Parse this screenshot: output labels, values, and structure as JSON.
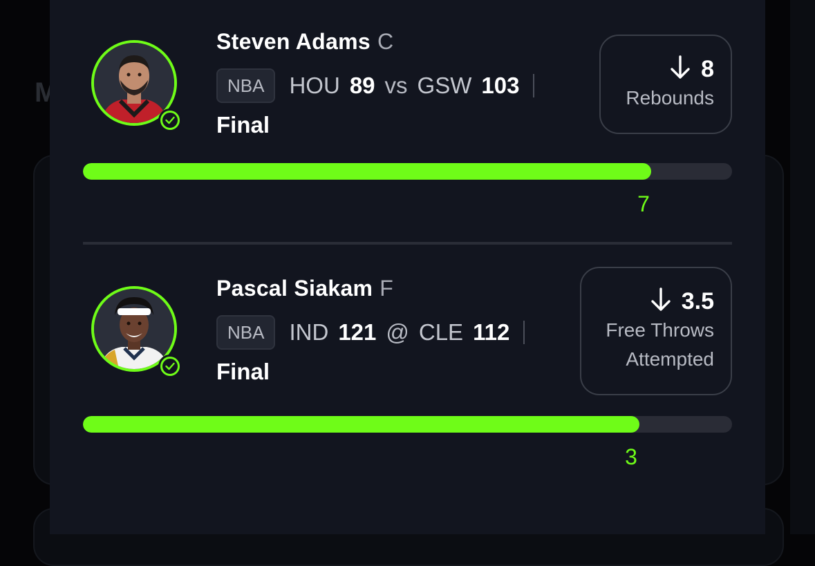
{
  "background": {
    "partial_letter": "M"
  },
  "accent_color": "#6ffc18",
  "picks": [
    {
      "player_name": "Steven Adams",
      "position": "C",
      "league": "NBA",
      "team1": "HOU",
      "score1": "89",
      "separator": "vs",
      "team2": "GSW",
      "score2": "103",
      "status": "Final",
      "direction_icon": "arrow-down-icon",
      "line_value": "8",
      "stat_lines": [
        "Rebounds"
      ],
      "actual_value": "7",
      "progress_fraction": 0.875
    },
    {
      "player_name": "Pascal Siakam",
      "position": "F",
      "league": "NBA",
      "team1": "IND",
      "score1": "121",
      "separator": "@",
      "team2": "CLE",
      "score2": "112",
      "status": "Final",
      "direction_icon": "arrow-down-icon",
      "line_value": "3.5",
      "stat_lines": [
        "Free Throws",
        "Attempted"
      ],
      "actual_value": "3",
      "progress_fraction": 0.857
    }
  ]
}
